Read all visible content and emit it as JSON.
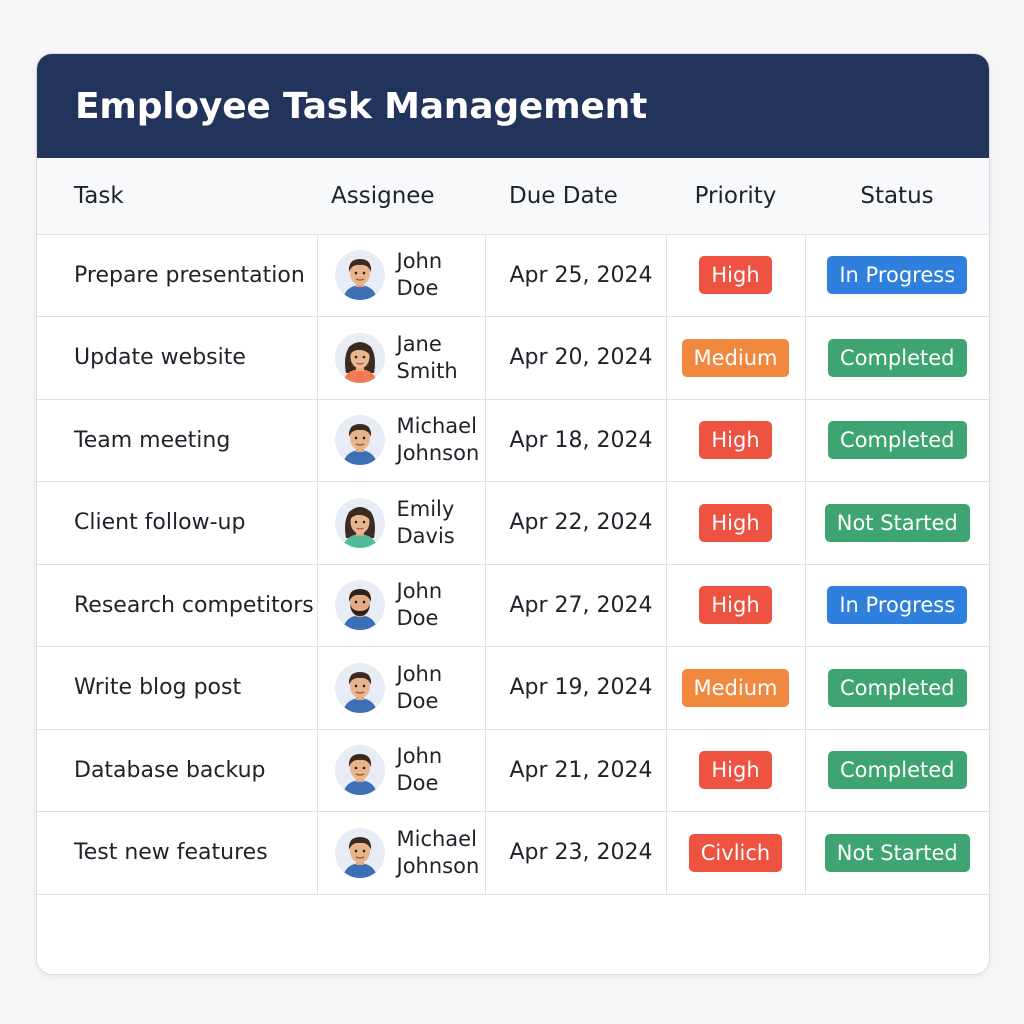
{
  "title": "Employee Task Management",
  "columns": [
    "Task",
    "Assignee",
    "Due Date",
    "Priority",
    "Status"
  ],
  "colors": {
    "header_bg": "#22345c",
    "priority": {
      "High": "#ee5241",
      "Medium": "#f0893f",
      "Civlich": "#ee5241"
    },
    "status": {
      "In Progress": "#2f7fdc",
      "Completed": "#3da472",
      "Not Started": "#3da472"
    }
  },
  "rows": [
    {
      "task": "Prepare presentation",
      "assignee": [
        "John",
        "Doe"
      ],
      "avatar": "male-avatar-icon",
      "due": "Apr 25, 2024",
      "priority": "High",
      "status": "In Progress"
    },
    {
      "task": "Update website",
      "assignee": [
        "Jane",
        "Smith"
      ],
      "avatar": "female-avatar-icon",
      "due": "Apr 20, 2024",
      "priority": "Medium",
      "status": "Completed"
    },
    {
      "task": "Team meeting",
      "assignee": [
        "Michael",
        "Johnson"
      ],
      "avatar": "male-avatar-icon",
      "due": "Apr 18, 2024",
      "priority": "High",
      "status": "Completed"
    },
    {
      "task": "Client follow-up",
      "assignee": [
        "Emily",
        "Davis"
      ],
      "avatar": "female-avatar-icon",
      "due": "Apr 22, 2024",
      "priority": "High",
      "status": "Not Started"
    },
    {
      "task": "Research competitors",
      "assignee": [
        "John",
        "Doe"
      ],
      "avatar": "bearded-male-avatar-icon",
      "due": "Apr 27, 2024",
      "priority": "High",
      "status": "In Progress"
    },
    {
      "task": "Write blog post",
      "assignee": [
        "John",
        "Doe"
      ],
      "avatar": "male-avatar-icon",
      "due": "Apr 19, 2024",
      "priority": "Medium",
      "status": "Completed"
    },
    {
      "task": "Database backup",
      "assignee": [
        "John",
        "Doe"
      ],
      "avatar": "male-avatar-icon",
      "due": "Apr 21, 2024",
      "priority": "High",
      "status": "Completed"
    },
    {
      "task": "Test new features",
      "assignee": [
        "Michael",
        "Johnson"
      ],
      "avatar": "male-avatar-icon",
      "due": "Apr 23, 2024",
      "priority": "Civlich",
      "status": "Not Started"
    }
  ]
}
